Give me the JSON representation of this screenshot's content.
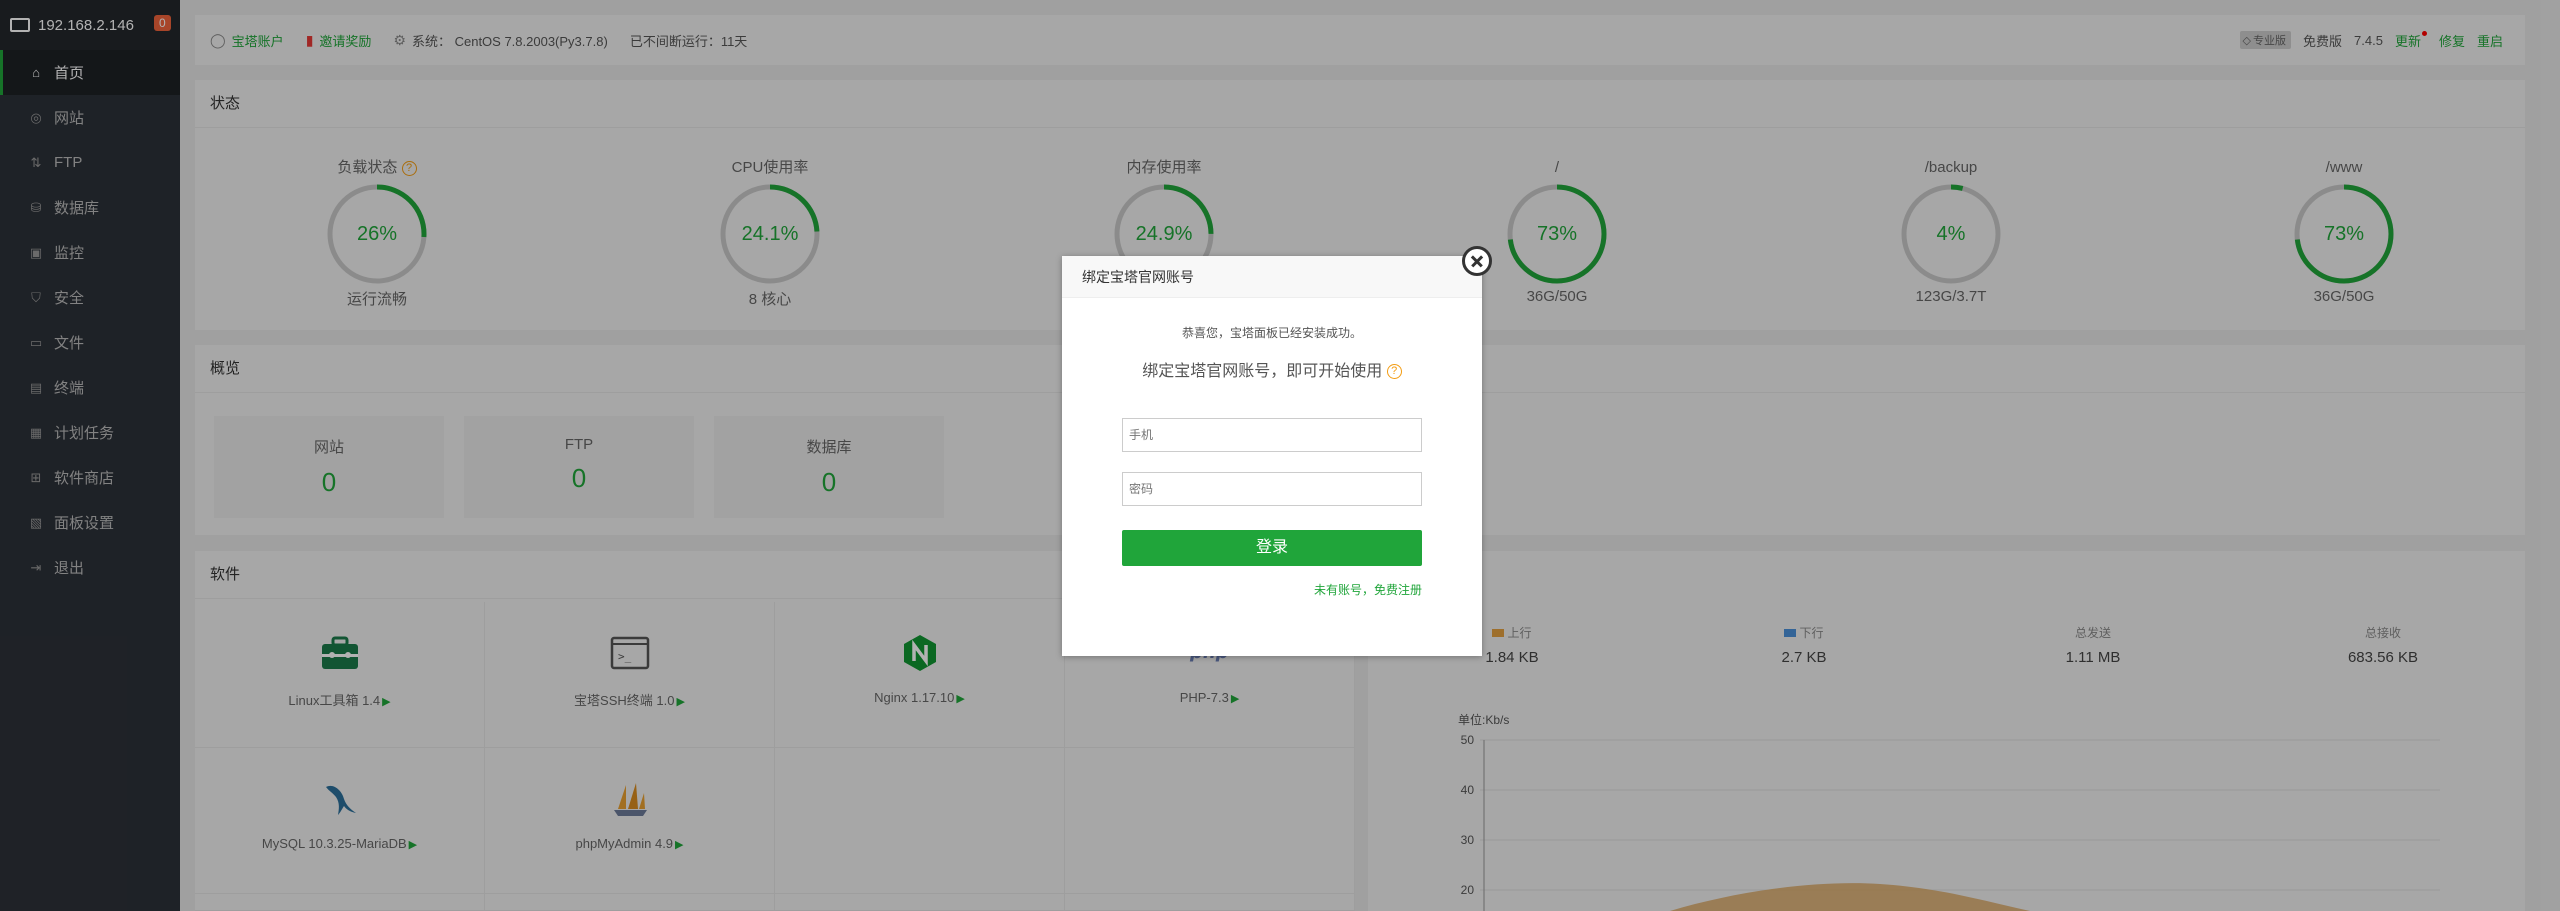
{
  "sidebar": {
    "host": "192.168.2.146",
    "badge": "0",
    "items": [
      {
        "label": "首页",
        "icon": "home-icon",
        "glyph": "⌂"
      },
      {
        "label": "网站",
        "icon": "globe-icon",
        "glyph": "◎"
      },
      {
        "label": "FTP",
        "icon": "ftp-icon",
        "glyph": "⇅"
      },
      {
        "label": "数据库",
        "icon": "database-icon",
        "glyph": "⛁"
      },
      {
        "label": "监控",
        "icon": "monitor-icon",
        "glyph": "▣"
      },
      {
        "label": "安全",
        "icon": "shield-icon",
        "glyph": "⛉"
      },
      {
        "label": "文件",
        "icon": "folder-icon",
        "glyph": "▭"
      },
      {
        "label": "终端",
        "icon": "terminal-icon",
        "glyph": "▤"
      },
      {
        "label": "计划任务",
        "icon": "calendar-icon",
        "glyph": "▦"
      },
      {
        "label": "软件商店",
        "icon": "apps-icon",
        "glyph": "⊞"
      },
      {
        "label": "面板设置",
        "icon": "settings-icon",
        "glyph": "▧"
      },
      {
        "label": "退出",
        "icon": "logout-icon",
        "glyph": "⇥"
      }
    ]
  },
  "topbar": {
    "account": "宝塔账户",
    "invite": "邀请奖励",
    "system": "系统：  CentOS 7.8.2003(Py3.7.8)",
    "uptime": "已不间断运行：11天",
    "edition_badge": "专业版",
    "free": "免费版",
    "version": "7.4.5",
    "update": "更新",
    "repair": "修复",
    "restart": "重启"
  },
  "status": {
    "title": "状态",
    "gauges": [
      {
        "label": "负载状态",
        "value": "26%",
        "sub": "运行流畅",
        "percent": 26,
        "help": "?"
      },
      {
        "label": "CPU使用率",
        "value": "24.1%",
        "sub": "8 核心",
        "percent": 24.1
      },
      {
        "label": "内存使用率",
        "value": "24.9%",
        "sub": "",
        "percent": 24.9
      },
      {
        "label": "/",
        "value": "73%",
        "sub": "36G/50G",
        "percent": 73
      },
      {
        "label": "/backup",
        "value": "4%",
        "sub": "123G/3.7T",
        "percent": 4
      },
      {
        "label": "/www",
        "value": "73%",
        "sub": "36G/50G",
        "percent": 73
      }
    ]
  },
  "overview": {
    "title": "概览",
    "cards": [
      {
        "label": "网站",
        "value": "0"
      },
      {
        "label": "FTP",
        "value": "0"
      },
      {
        "label": "数据库",
        "value": "0"
      }
    ]
  },
  "software": {
    "title": "软件",
    "items": [
      {
        "name": "Linux工具箱 1.4",
        "icon": "toolbox-icon"
      },
      {
        "name": "宝塔SSH终端 1.0",
        "icon": "terminal-icon"
      },
      {
        "name": "Nginx 1.17.10",
        "icon": "nginx-icon"
      },
      {
        "name": "PHP-7.3",
        "icon": "php-icon"
      },
      {
        "name": "MySQL 10.3.25-MariaDB",
        "icon": "mysql-icon"
      },
      {
        "name": "phpMyAdmin 4.9",
        "icon": "phpmyadmin-icon"
      }
    ],
    "arrow": "▶"
  },
  "traffic": {
    "stats": [
      {
        "label": "上行",
        "value": "1.84 KB",
        "color": "#e2a03f"
      },
      {
        "label": "下行",
        "value": "2.7 KB",
        "color": "#4a90d9"
      },
      {
        "label": "总发送",
        "value": "1.11 MB"
      },
      {
        "label": "总接收",
        "value": "683.56 KB"
      }
    ],
    "chart_data": {
      "type": "area",
      "ylabel": "单位:Kb/s",
      "ylim": [
        20,
        50
      ],
      "yticks": [
        "50",
        "40",
        "30",
        "20"
      ]
    }
  },
  "modal": {
    "title": "绑定宝塔官网账号",
    "msg1": "恭喜您，宝塔面板已经安装成功。",
    "msg2": "绑定宝塔官网账号，即可开始使用",
    "help": "?",
    "phone_placeholder": "手机",
    "password_placeholder": "密码",
    "login": "登录",
    "register": "未有账号，免费注册"
  },
  "colors": {
    "accent": "#20a53a",
    "sidebar": "#2c3138"
  }
}
